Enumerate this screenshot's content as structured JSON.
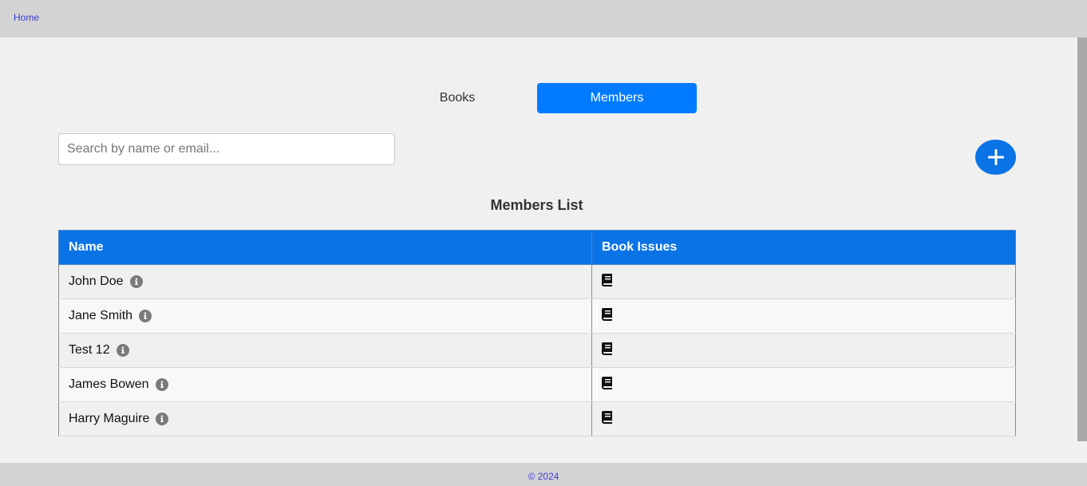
{
  "nav": {
    "home_label": "Home"
  },
  "tabs": [
    {
      "label": "Books",
      "active": false
    },
    {
      "label": "Members",
      "active": true
    }
  ],
  "search": {
    "placeholder": "Search by name or email...",
    "value": ""
  },
  "add_button": {
    "icon": "plus-icon"
  },
  "members_list": {
    "title": "Members List",
    "columns": [
      "Name",
      "Book Issues"
    ],
    "rows": [
      {
        "name": "John Doe",
        "info_icon": "info-icon",
        "issues_icon": "book-icon"
      },
      {
        "name": "Jane Smith",
        "info_icon": "info-icon",
        "issues_icon": "book-icon"
      },
      {
        "name": "Test 12",
        "info_icon": "info-icon",
        "issues_icon": "book-icon"
      },
      {
        "name": "James Bowen",
        "info_icon": "info-icon",
        "issues_icon": "book-icon"
      },
      {
        "name": "Harry Maguire",
        "info_icon": "info-icon",
        "issues_icon": "book-icon"
      }
    ]
  },
  "footer": {
    "text": "© 2024"
  },
  "colors": {
    "accent": "#007bff",
    "table_header": "#0a73e6",
    "link": "#3b3bd6",
    "bar": "#d3d3d3"
  }
}
